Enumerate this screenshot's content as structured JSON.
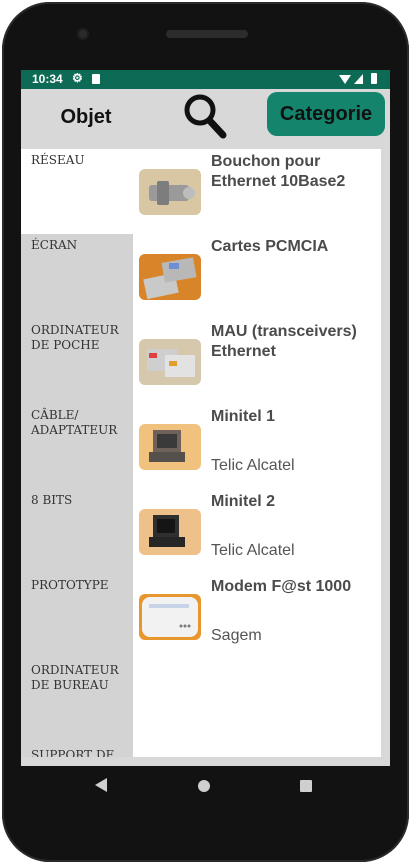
{
  "status_bar": {
    "time": "10:34",
    "icons": [
      "gear-icon",
      "sd-card-icon",
      "wifi-icon",
      "signal-icon",
      "battery-icon"
    ]
  },
  "toolbar": {
    "objet_label": "Objet",
    "search_icon": "search-icon",
    "categorie_label": "Categorie"
  },
  "colors": {
    "status_bar": "#0d6b55",
    "accent_button": "#14846c",
    "background": "#d8d8d8"
  },
  "categories": [
    {
      "label": "Réseau",
      "selected": true
    },
    {
      "label": "Écran",
      "selected": false
    },
    {
      "label": "Ordinateur\nde poche",
      "selected": false
    },
    {
      "label": "Câble/\nadaptateur",
      "selected": false
    },
    {
      "label": "8 bits",
      "selected": false
    },
    {
      "label": "Prototype",
      "selected": false
    },
    {
      "label": "Ordinateur\nde bureau",
      "selected": false
    },
    {
      "label": "Support de",
      "selected": false
    }
  ],
  "items": [
    {
      "title": "Bouchon pour Ethernet 10Base2",
      "subtitle": ""
    },
    {
      "title": "Cartes PCMCIA",
      "subtitle": ""
    },
    {
      "title": "MAU (transceivers) Ethernet",
      "subtitle": ""
    },
    {
      "title": "Minitel 1",
      "subtitle": "Telic Alcatel"
    },
    {
      "title": "Minitel 2",
      "subtitle": "Telic Alcatel"
    },
    {
      "title": "Modem F@st 1000",
      "subtitle": "Sagem"
    }
  ]
}
